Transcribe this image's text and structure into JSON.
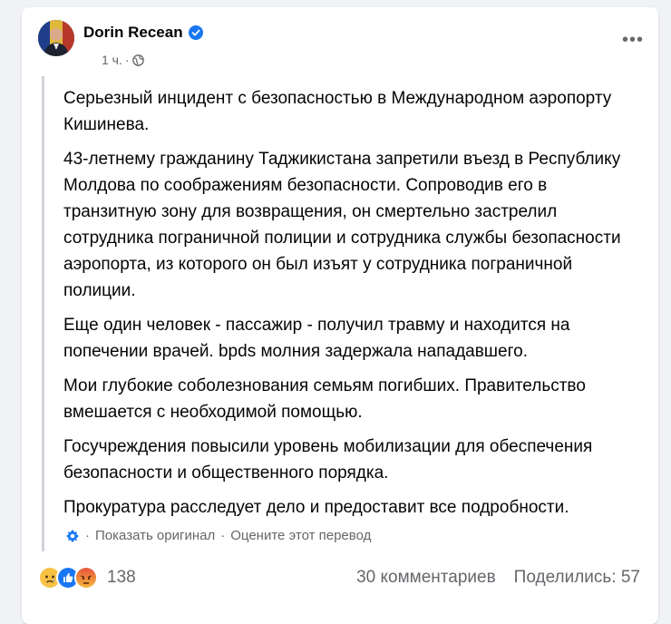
{
  "post": {
    "author": "Dorin Recean",
    "time": "1 ч.",
    "time_separator": "·",
    "paragraphs": [
      "Серьезный инцидент с безопасностью в Международном аэропорту Кишинева.",
      "43-летнему гражданину Таджикистана запретили въезд в Республику Молдова по соображениям безопасности. Сопроводив его в транзитную зону для возвращения, он смертельно застрелил сотрудника пограничной полиции и сотрудника службы безопасности аэропорта, из которого он был изъят у сотрудника пограничной полиции.",
      "Еще один человек - пассажир - получил травму и находится на попечении врачей. bpds молния задержала нападавшего.",
      "Мои глубокие соболезнования семьям погибших. Правительство вмешается с необходимой помощью.",
      "Госучреждения повысили уровень мобилизации для обеспечения безопасности и общественного порядка.",
      "Прокуратура расследует дело и предоставит все подробности."
    ]
  },
  "translation": {
    "show_original": "Показать оригинал",
    "separator": "·",
    "rate": "Оцените этот перевод"
  },
  "footer": {
    "reaction_count": "138",
    "comments": "30 комментариев",
    "shares": "Поделились: 57"
  },
  "icons": {
    "verified": "verified-badge-icon",
    "audience": "globe-icon",
    "more": "more-horizontal-icon",
    "translate": "translate-gear-icon",
    "reactions": [
      "sad-reaction-icon",
      "like-reaction-icon",
      "angry-reaction-icon"
    ]
  },
  "colors": {
    "accent": "#1877f2",
    "secondary_text": "#65676b",
    "background": "#f0f2f5"
  }
}
